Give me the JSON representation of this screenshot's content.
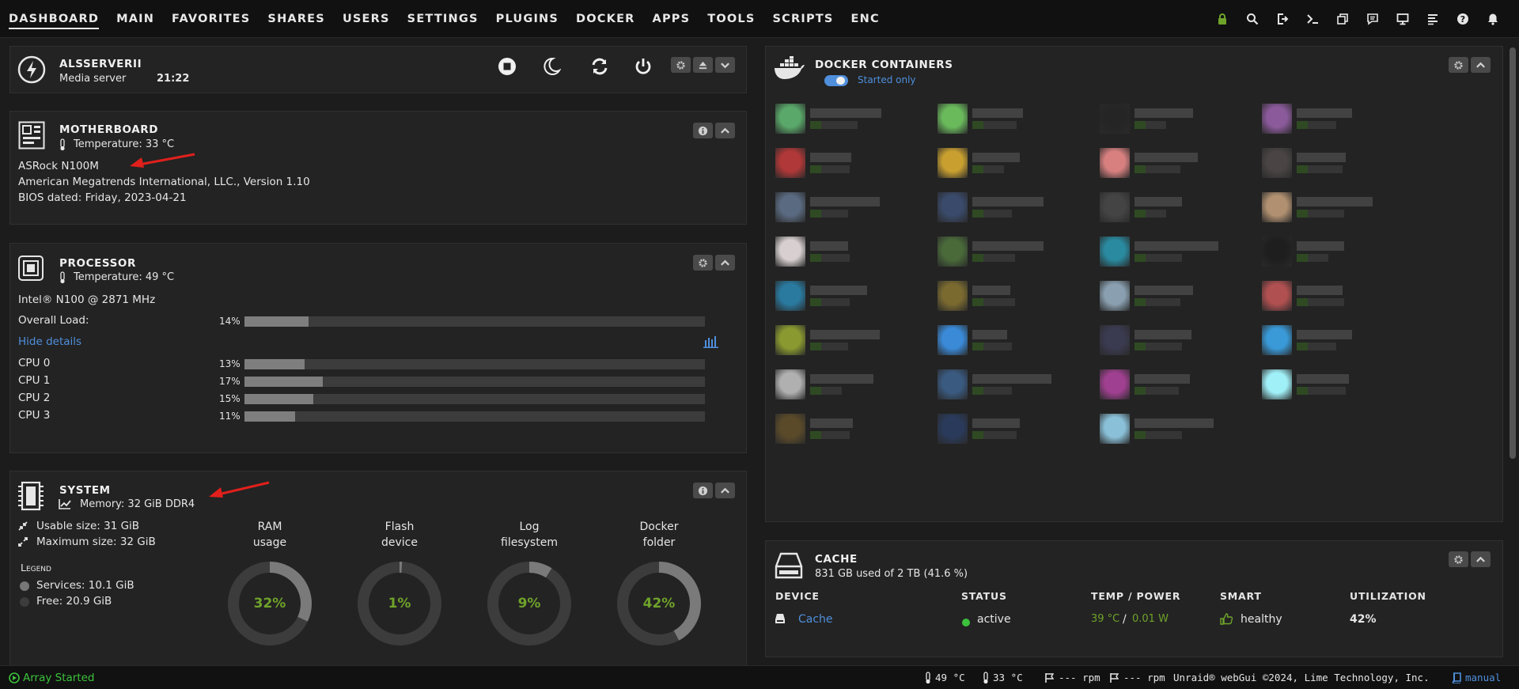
{
  "nav": {
    "items": [
      "DASHBOARD",
      "MAIN",
      "FAVORITES",
      "SHARES",
      "USERS",
      "SETTINGS",
      "PLUGINS",
      "DOCKER",
      "APPS",
      "TOOLS",
      "SCRIPTS",
      "ENC"
    ],
    "active": "DASHBOARD",
    "icons": [
      "lock-icon",
      "search-icon",
      "logout-icon",
      "terminal-icon",
      "windows-icon",
      "feedback-icon",
      "monitor-icon",
      "log-icon",
      "help-icon",
      "bell-icon"
    ]
  },
  "server": {
    "name": "ALSSERVERII",
    "description": "Media server",
    "time": "21:22"
  },
  "motherboard": {
    "title": "MOTHERBOARD",
    "temperature": "Temperature: 33 °C",
    "model": "ASRock N100M",
    "bios_vendor": "American Megatrends International, LLC., Version 1.10",
    "bios_date": "BIOS dated: Friday, 2023-04-21"
  },
  "processor": {
    "title": "PROCESSOR",
    "temperature": "Temperature: 49 °C",
    "model": "Intel® N100 @ 2871 MHz",
    "overall_label": "Overall Load:",
    "overall_pct": "14%",
    "overall_value": 14,
    "toggle": "Hide details",
    "cpus": [
      {
        "label": "CPU 0",
        "pct": "13%",
        "value": 13
      },
      {
        "label": "CPU 1",
        "pct": "17%",
        "value": 17
      },
      {
        "label": "CPU 2",
        "pct": "15%",
        "value": 15
      },
      {
        "label": "CPU 3",
        "pct": "11%",
        "value": 11
      }
    ]
  },
  "system": {
    "title": "SYSTEM",
    "memory": "Memory: 32 GiB DDR4",
    "usable": "Usable size: 31 GiB",
    "maximum": "Maximum size: 32 GiB",
    "legend_title": "Legend",
    "legend": [
      {
        "label": "Services: 10.1 GiB",
        "color": "#777777"
      },
      {
        "label": "Free: 20.9 GiB",
        "color": "#3c3c3c"
      }
    ],
    "donuts": [
      {
        "cap1": "RAM",
        "cap2": "usage",
        "pct": "32%",
        "value": 32
      },
      {
        "cap1": "Flash",
        "cap2": "device",
        "pct": "1%",
        "value": 1
      },
      {
        "cap1": "Log",
        "cap2": "filesystem",
        "pct": "9%",
        "value": 9
      },
      {
        "cap1": "Docker",
        "cap2": "folder",
        "pct": "42%",
        "value": 42
      }
    ]
  },
  "docker": {
    "title": "DOCKER CONTAINERS",
    "toggle_label": "Started only",
    "containers": [
      {
        "color": "#5aa86a"
      },
      {
        "color": "#6aba5c"
      },
      {
        "color": "#252525"
      },
      {
        "color": "#8a5a9a"
      },
      {
        "color": "#b03838"
      },
      {
        "color": "#c9a030"
      },
      {
        "color": "#d88080"
      },
      {
        "color": "#4a4444"
      },
      {
        "color": "#5a6a80"
      },
      {
        "color": "#3a4a6a"
      },
      {
        "color": "#444444"
      },
      {
        "color": "#b09070"
      },
      {
        "color": "#d8d0d0"
      },
      {
        "color": "#4a6a3a"
      },
      {
        "color": "#2a8aa0"
      },
      {
        "color": "#1e1e1e"
      },
      {
        "color": "#2a7aa0"
      },
      {
        "color": "#7a6a30"
      },
      {
        "color": "#8aa0b0"
      },
      {
        "color": "#b05050"
      },
      {
        "color": "#8a9a30"
      },
      {
        "color": "#3a8ad8"
      },
      {
        "color": "#3a3a50"
      },
      {
        "color": "#3a9ad8"
      },
      {
        "color": "#b0b0b0"
      },
      {
        "color": "#3a5a80"
      },
      {
        "color": "#a04090"
      },
      {
        "color": "#a0f0f8"
      },
      {
        "color": "#5a4a2a"
      },
      {
        "color": "#2a3a5a"
      },
      {
        "color": "#8ac0d8"
      }
    ]
  },
  "cache": {
    "title": "CACHE",
    "usage": "831 GB used of 2 TB (41.6 %)",
    "headers": [
      "DEVICE",
      "STATUS",
      "TEMP / POWER",
      "SMART",
      "UTILIZATION"
    ],
    "device": "Cache",
    "status": "active",
    "temp": "39 °C",
    "power": "0.01 W",
    "smart": "healthy",
    "utilization": "42%"
  },
  "footer": {
    "array_status": "Array Started",
    "cpu_temp": "49 °C",
    "mb_temp": "33 °C",
    "fan1": "--- rpm",
    "fan2": "--- rpm",
    "copyright": "Unraid® webGui ©2024, Lime Technology, Inc.",
    "manual": "manual"
  }
}
